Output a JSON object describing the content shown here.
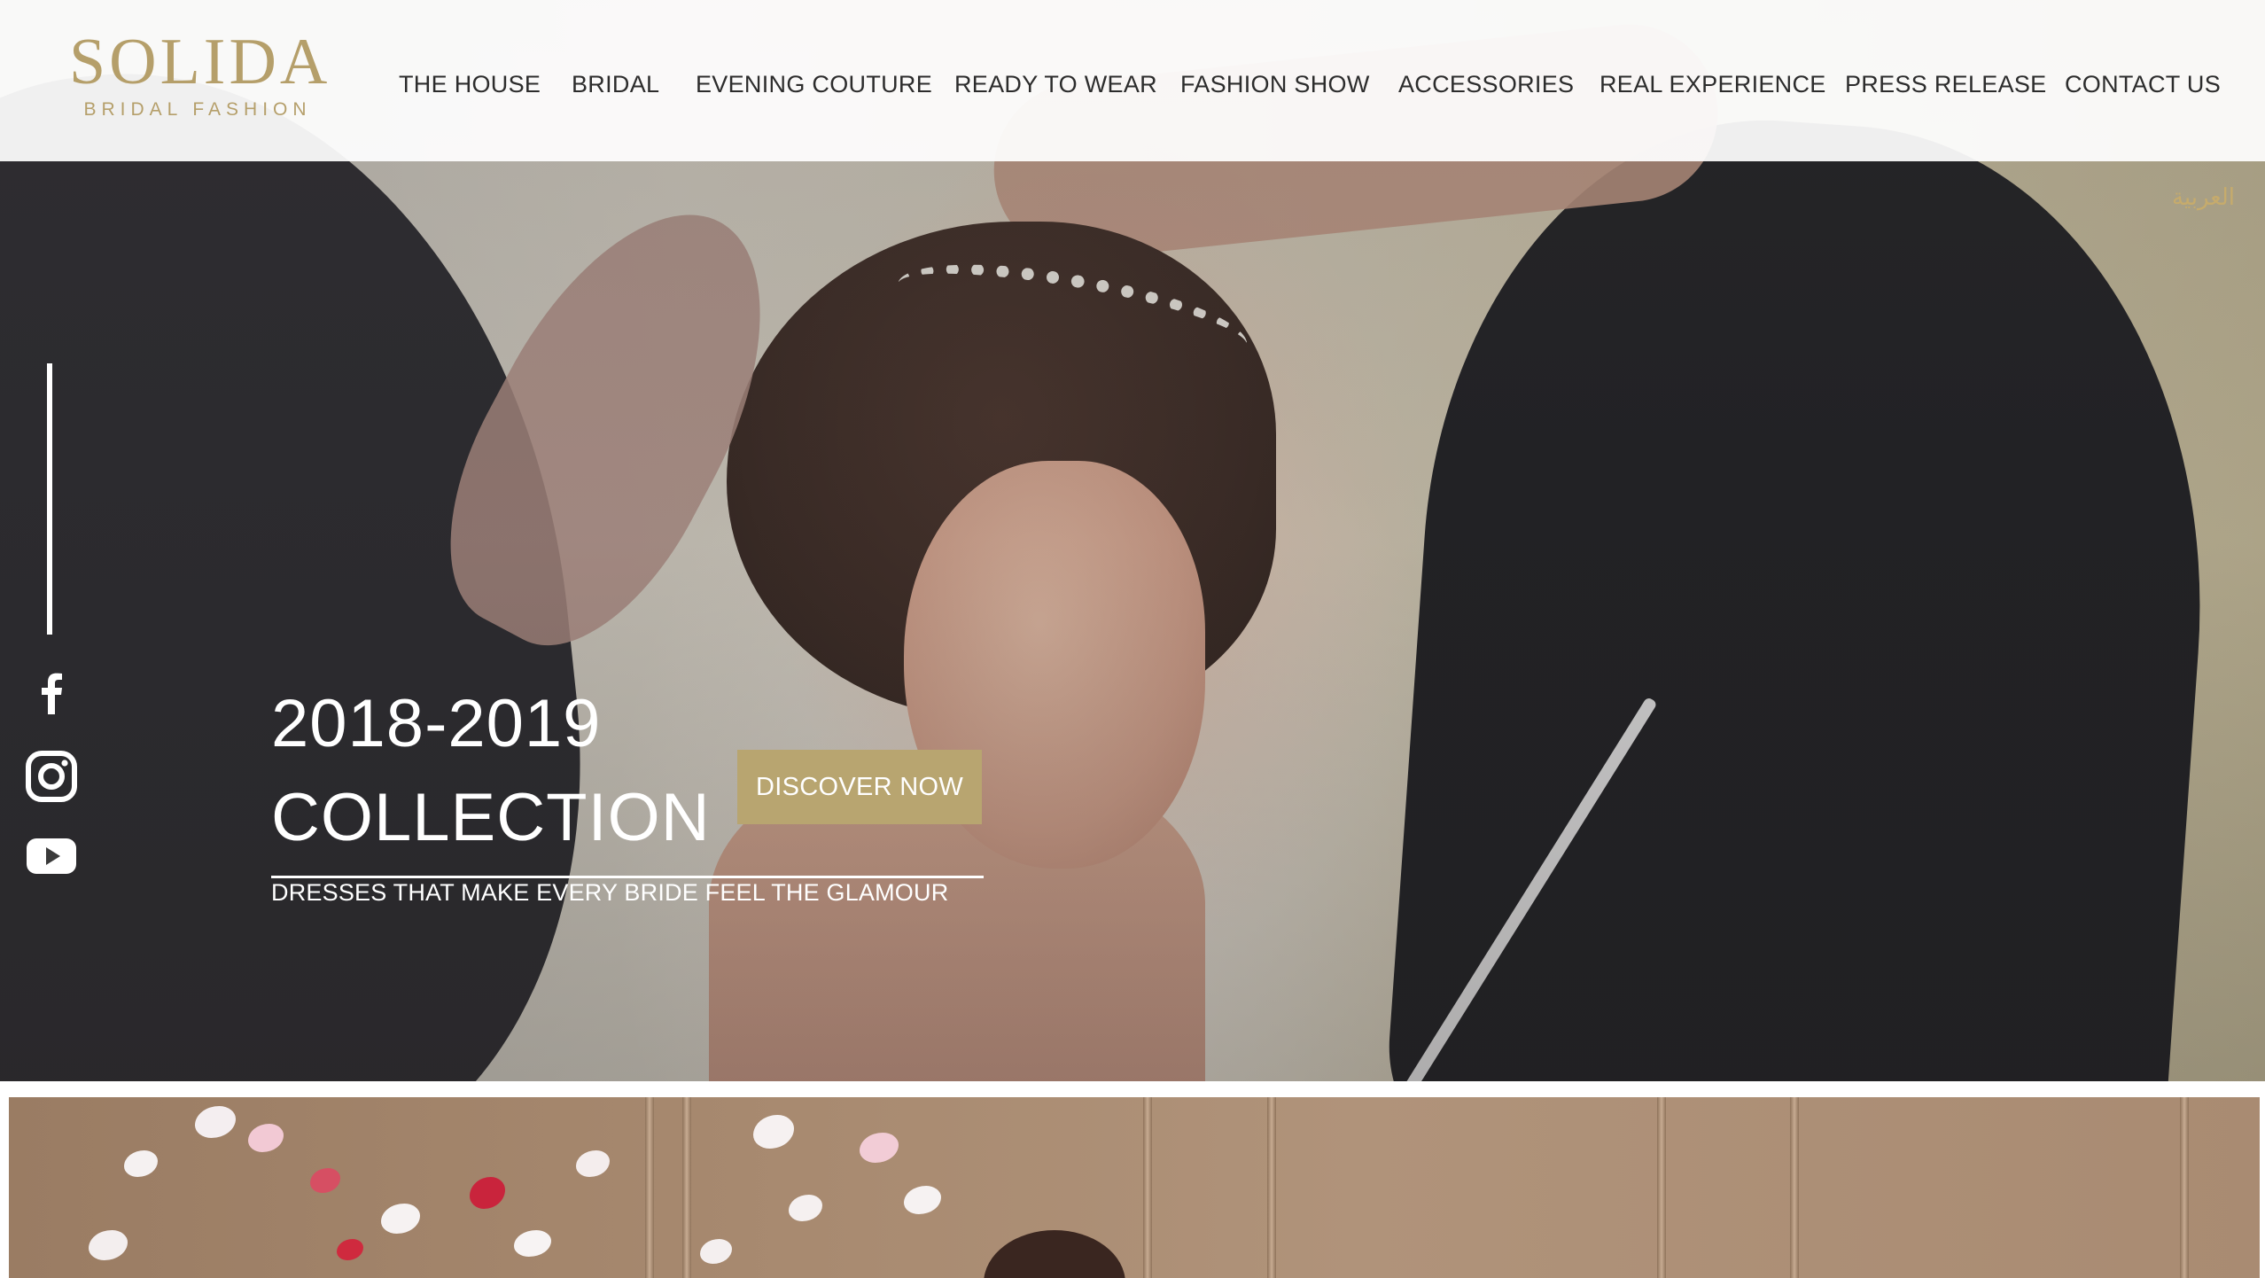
{
  "brand": {
    "name": "SOLIDA",
    "tagline": "BRIDAL FASHION",
    "color": "#b59f6a"
  },
  "nav": {
    "items": [
      {
        "label": "THE HOUSE"
      },
      {
        "label": "BRIDAL"
      },
      {
        "label": "EVENING COUTURE"
      },
      {
        "label": "READY TO WEAR"
      },
      {
        "label": "FASHION SHOW"
      },
      {
        "label": "ACCESSORIES"
      },
      {
        "label": "REAL EXPERIENCE"
      },
      {
        "label": "PRESS RELEASE"
      },
      {
        "label": "CONTACT US"
      }
    ]
  },
  "language_link": "العربية",
  "social": [
    {
      "icon": "facebook-icon"
    },
    {
      "icon": "instagram-icon"
    },
    {
      "icon": "youtube-icon"
    }
  ],
  "hero": {
    "title_line1": "2018-2019",
    "title_line2": "COLLECTION",
    "subtitle": "DRESSES THAT MAKE EVERY BRIDE FEEL THE GLAMOUR",
    "cta_label": "DISCOVER NOW",
    "cta_color": "#b8a570"
  }
}
